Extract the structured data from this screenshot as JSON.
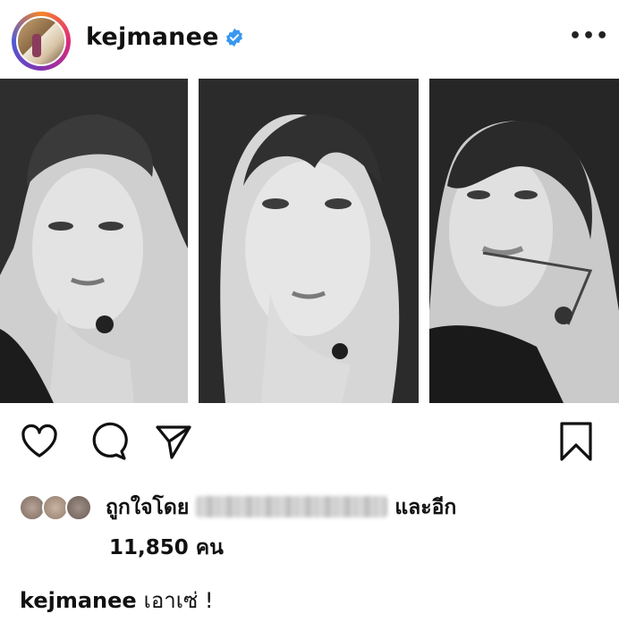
{
  "post": {
    "username": "kejmanee",
    "verified_icon": "verified-badge-icon",
    "more_icon": "more-options-icon",
    "more_label": "•••"
  },
  "actions": {
    "like_icon": "heart-icon",
    "comment_icon": "comment-icon",
    "share_icon": "send-icon",
    "save_icon": "bookmark-icon"
  },
  "likes": {
    "liked_by_prefix": "ถูกใจโดย",
    "liked_by_suffix": "และอีก",
    "count_text": "11,850 คน"
  },
  "caption": {
    "username": "kejmanee",
    "text": "เอาเซ่ !"
  },
  "colors": {
    "verified": "#3897f0",
    "text": "#111111",
    "background": "#ffffff"
  }
}
